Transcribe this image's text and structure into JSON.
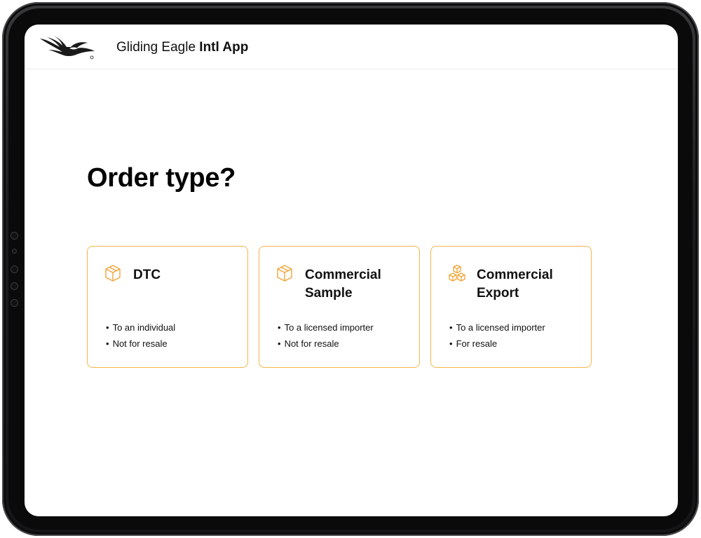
{
  "app": {
    "title_regular": "Gliding Eagle ",
    "title_bold": "Intl App",
    "logo_icon": "eagle-logo-icon"
  },
  "page": {
    "title": "Order type?"
  },
  "colors": {
    "accent": "#f5b64a",
    "icon": "#f0a53a"
  },
  "cards": [
    {
      "title": "DTC",
      "icon": "box-icon",
      "bullets": [
        "To an individual",
        "Not for resale"
      ]
    },
    {
      "title": "Commercial Sample",
      "icon": "box-icon",
      "bullets": [
        "To a licensed importer",
        "Not for resale"
      ]
    },
    {
      "title": "Commercial Export",
      "icon": "boxes-stack-icon",
      "bullets": [
        "To a licensed importer",
        "For resale"
      ]
    }
  ]
}
